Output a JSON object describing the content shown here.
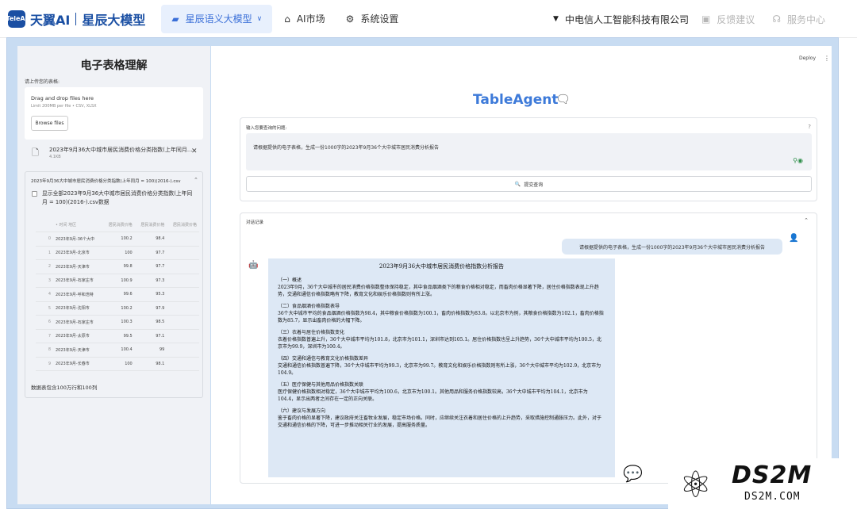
{
  "header": {
    "logo_badge": "TeleAI",
    "brand": "天翼AI",
    "model_name": "星辰大模型",
    "tabs": [
      {
        "icon": "semantic-model-icon",
        "label": "星辰语义大模型",
        "active": true,
        "chevron": "∨"
      },
      {
        "icon": "store-icon",
        "label": "AI市场",
        "active": false
      },
      {
        "icon": "gear-icon",
        "label": "系统设置",
        "active": false
      }
    ],
    "organization": "中电信人工智能科技有限公司",
    "feedback": "反馈建议",
    "service": "服务中心"
  },
  "sidebar": {
    "title": "电子表格理解",
    "upload_label": "请上传您的表格:",
    "dropzone_title": "Drag and drop files here",
    "dropzone_limit": "Limit 200MB per file • CSV, XLSX",
    "browse_label": "Browse files",
    "file": {
      "name": "2023年9月36大中城市居民消费价格分类指数(上年同月...",
      "size": "4.1KB"
    },
    "expander_title": "2023年9月36大中城市居民消费价格分类指数(上年同月 = 100)(2016-).csv",
    "checkbox_label": "显示全部2023年9月36大中城市居民消费价格分类指数(上年同月 = 100)(2016-).csv数据",
    "table": {
      "columns": [
        "",
        "• 时间 地区",
        "居民消费价格",
        "居民消费价格",
        "居民消费价格"
      ],
      "rows": [
        [
          "0",
          "2023年9月-36个大中",
          "100.2",
          "98.4",
          ""
        ],
        [
          "1",
          "2023年9月-北京市",
          "100",
          "97.7",
          ""
        ],
        [
          "2",
          "2023年9月-天津市",
          "99.8",
          "97.7",
          ""
        ],
        [
          "3",
          "2023年9月-石家庄市",
          "100.9",
          "97.3",
          ""
        ],
        [
          "4",
          "2023年9月-呼和浩特",
          "99.6",
          "95.3",
          ""
        ],
        [
          "5",
          "2023年9月-沈阳市",
          "100.2",
          "97.9",
          ""
        ],
        [
          "6",
          "2023年9月-石家庄市",
          "100.3",
          "98.5",
          ""
        ],
        [
          "7",
          "2023年9月-太原市",
          "99.5",
          "97.1",
          ""
        ],
        [
          "8",
          "2023年9月-天津市",
          "100.4",
          "99",
          ""
        ],
        [
          "9",
          "2023年9月-长春市",
          "100",
          "98.1",
          ""
        ]
      ]
    },
    "summary": "数据表包含100万行和100列"
  },
  "main": {
    "deploy": "Deploy",
    "kebab": "⋮",
    "title": "TableAgent",
    "query_label": "输入您要查询的问题:",
    "query_text": "请根据提供的电子表格，生成一份1000字的2023年9月36个大中城市居民消费分析报告",
    "submit_label": "提交查询",
    "chat_label": "对话记录",
    "user_message": "请根据提供的电子表格，生成一份1000字的2023年9月36个大中城市居民消费分析报告",
    "report": {
      "title": "2023年9月36大中城市居民消费价格指数分析报告",
      "sections": [
        {
          "heading": "（一）概述",
          "body": "2023年9月，36个大中城市的居民消费价格指数整体保持稳定，其中食品烟酒类下的粮食价格相对稳定，而畜肉价格显著下降，居住价格指数表现上升趋势，交通和通信价格指数略有下降，教育文化和娱乐价格指数则有所上涨。"
        },
        {
          "heading": "（二）食品烟酒价格指数表导",
          "body": "36个大中城市平均的食品烟酒价格指数为98.4，其中粮食价格指数为100.1，畜肉价格指数为83.8。以北京市为例，其粮食价格指数为102.1，畜肉价格指数为85.7，显示出畜肉价格的大幅下降。"
        },
        {
          "heading": "（三）衣着与居住价格指数变化",
          "body": "衣着价格指数普遍上升，36个大中城市平均为101.8，北京市为101.1，深圳市达到105.1。居住价格指数也呈上升趋势，36个大中城市平均为100.5，北京市为99.9，深圳市为100.4。"
        },
        {
          "heading": "（四）交通和通信与教育文化价格指数差异",
          "body": "交通和通信价格指数普遍下降，36个大中城市平均为99.3，北京市为99.7。教育文化和娱乐价格指数则有所上涨，36个大中城市平均为102.9，北京市为104.9。"
        },
        {
          "heading": "（五）医疗保健与其他用品价格指数关联",
          "body": "医疗保健价格指数相对稳定，36个大中城市平均为100.6，北京市为100.1。其他用品和服务价格指数较高，36个大中城市平均为104.1，北京市为104.4，显示出两者之间存在一定的正向关联。"
        },
        {
          "heading": "（六）建议与发展方向",
          "body": "鉴于畜肉价格的显著下降，建议政府关注畜牧业发展，稳定市场价格。同时，应继续关注衣着和居住价格的上升趋势，采取措施控制通胀压力。此外，对于交通和通信价格的下降，可进一步推动相关行业的发展，提高服务质量。"
        }
      ]
    }
  },
  "watermark": {
    "brand": "DS2M",
    "site": "DS2M.COM"
  }
}
